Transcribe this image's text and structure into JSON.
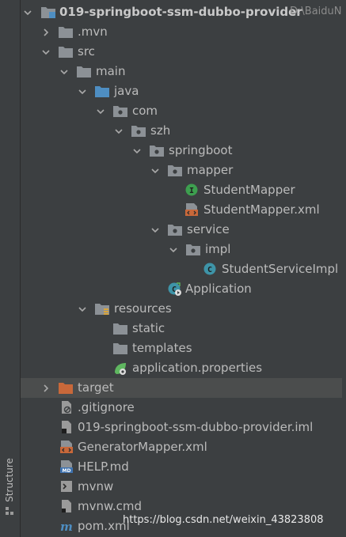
{
  "side_tab": {
    "label": "Structure"
  },
  "tree": {
    "root": {
      "label": "019-springboot-ssm-dubbo-provider",
      "path_hint": "D:\\BaiduN"
    },
    "mvn": ".mvn",
    "src": "src",
    "main": "main",
    "java": "java",
    "com": "com",
    "szh": "szh",
    "springboot": "springboot",
    "mapper": "mapper",
    "student_mapper": "StudentMapper",
    "student_mapper_xml": "StudentMapper.xml",
    "service": "service",
    "impl": "impl",
    "student_service_impl": "StudentServiceImpl",
    "application": "Application",
    "resources": "resources",
    "static": "static",
    "templates": "templates",
    "application_properties": "application.properties",
    "target": "target",
    "gitignore": ".gitignore",
    "iml": "019-springboot-ssm-dubbo-provider.iml",
    "generator_mapper": "GeneratorMapper.xml",
    "help": "HELP.md",
    "mvnw": "mvnw",
    "mvnw_cmd": "mvnw.cmd",
    "pom": "pom.xml"
  },
  "watermark": "https://blog.csdn.net/weixin_43823808",
  "colors": {
    "background": "#3c3f41",
    "selected_row": "#4b4d4d",
    "folder": "#8c9196",
    "source_folder": "#4e8ec2",
    "excluded_folder": "#c8683a",
    "interface_icon": "#3d9f4f",
    "class_icon": "#3e94a8",
    "text": "#bbbbbb"
  }
}
